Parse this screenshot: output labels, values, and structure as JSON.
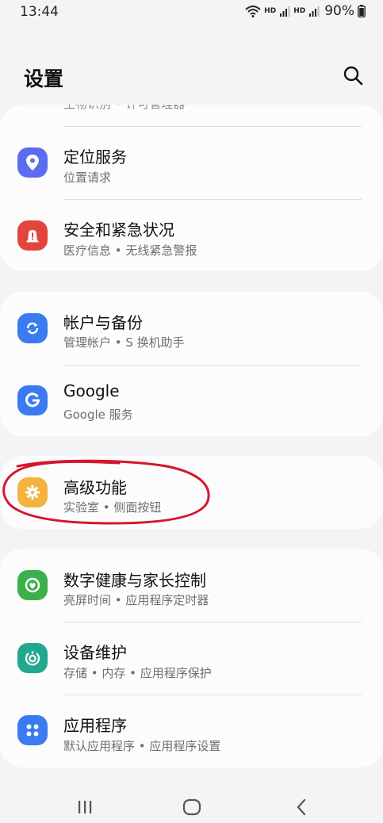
{
  "status_bar": {
    "time": "13:44",
    "hd1": "HD",
    "hd2": "HD",
    "battery": "90%"
  },
  "header": {
    "title": "设置",
    "search_icon": "search-icon"
  },
  "groups": [
    {
      "clipped_subtitle": "生物识别 • 许可管理器",
      "items": [
        {
          "title": "定位服务",
          "subtitle": "位置请求",
          "icon": "location-pin-icon",
          "color": "#5b6cf0"
        },
        {
          "title": "安全和紧急状况",
          "subtitle": "医疗信息 • 无线紧急警报",
          "icon": "emergency-icon",
          "color": "#e2453c"
        }
      ]
    },
    {
      "items": [
        {
          "title": "帐户与备份",
          "subtitle": "管理帐户 • S 换机助手",
          "icon": "sync-icon",
          "color": "#3a7bf2"
        },
        {
          "title": "Google",
          "subtitle": "Google 服务",
          "icon": "google-icon",
          "color": "#3a7bf2"
        }
      ]
    },
    {
      "items": [
        {
          "title": "高级功能",
          "subtitle": "实验室 • 侧面按钮",
          "icon": "advanced-features-icon",
          "color": "#f3b33c"
        }
      ]
    },
    {
      "items": [
        {
          "title": "数字健康与家长控制",
          "subtitle": "亮屏时间 • 应用程序定时器",
          "icon": "digital-wellbeing-icon",
          "color": "#3cb04a"
        },
        {
          "title": "设备维护",
          "subtitle": "存储 • 内存 • 应用程序保护",
          "icon": "device-care-icon",
          "color": "#21a88e"
        },
        {
          "title": "应用程序",
          "subtitle": "默认应用程序 • 应用程序设置",
          "icon": "apps-icon",
          "color": "#3a7bf2"
        }
      ]
    }
  ],
  "nav": {
    "recents_icon": "recents-icon",
    "home_icon": "home-icon",
    "back_icon": "back-icon"
  },
  "annotation_color": "#d6162b"
}
